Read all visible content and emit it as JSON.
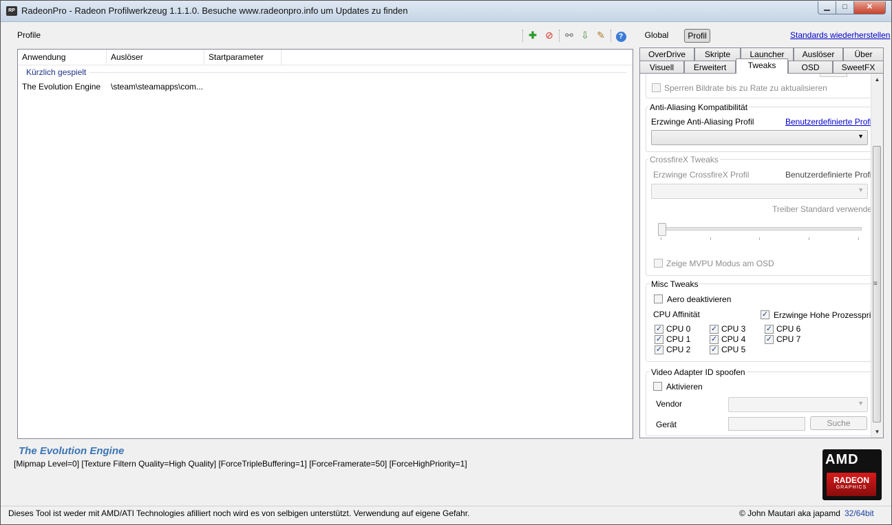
{
  "window": {
    "app_icon": "RP",
    "title": "RadeonPro - Radeon Profilwerkzeug 1.1.1.0. Besuche www.radeonpro.info um Updates zu finden",
    "min_icon": "minimize-icon",
    "max_icon": "maximize-icon",
    "close_icon": "close-icon"
  },
  "left": {
    "profile_label": "Profile",
    "toolbar": [
      {
        "name": "add-profile-icon",
        "glyph": "+"
      },
      {
        "name": "delete-profile-icon",
        "glyph": "⊘"
      },
      {
        "name": "link-icon",
        "glyph": "∞"
      },
      {
        "name": "import-icon",
        "glyph": "⇩"
      },
      {
        "name": "broom-icon",
        "glyph": "✎"
      },
      {
        "name": "help-icon",
        "glyph": "?"
      }
    ],
    "columns": [
      "Anwendung",
      "Auslöser",
      "Startparameter"
    ],
    "group": "Kürzlich gespielt",
    "rows": [
      {
        "app": "The Evolution Engine",
        "trigger": "\\steam\\steamapps\\com...",
        "params": ""
      }
    ]
  },
  "right": {
    "seg_global": "Global",
    "seg_profil": "Profil",
    "restore_link": "Standards wiederherstellen",
    "tabs_row1": [
      "OverDrive",
      "Skripte",
      "Launcher",
      "Auslöser",
      "Über"
    ],
    "tabs_row2": [
      "Visuell",
      "Erweitert",
      "Tweaks",
      "OSD",
      "SweetFX"
    ],
    "active_tab": "Tweaks",
    "lock_framerate": "Sperren Bildrate bis zu Rate zu aktualisieren",
    "aa_group": "Anti-Aliasing Kompatibilität",
    "aa_force": "Erzwinge Anti-Aliasing Profil",
    "aa_custom_link": "Benutzerdefinierte Profile v",
    "cfx_group": "CrossfireX Tweaks",
    "cfx_force": "Erzwinge CrossfireX Profil",
    "cfx_custom": "Benutzerdefinierte Profile v",
    "cfx_driver_default": "Treiber Standard verwenden",
    "cfx_slider_value": 0,
    "cfx_mvpu": "Zeige MVPU Modus am OSD",
    "misc_group": "Misc Tweaks",
    "aero": "Aero deaktivieren",
    "cpu_affinity": "CPU Affinität",
    "high_priority": "Erzwinge Hohe Prozesspriorität",
    "high_priority_checked": true,
    "cpus": [
      {
        "label": "CPU 0",
        "checked": true
      },
      {
        "label": "CPU 1",
        "checked": true
      },
      {
        "label": "CPU 2",
        "checked": true
      },
      {
        "label": "CPU 3",
        "checked": true
      },
      {
        "label": "CPU 4",
        "checked": true
      },
      {
        "label": "CPU 5",
        "checked": true
      },
      {
        "label": "CPU 6",
        "checked": true
      },
      {
        "label": "CPU 7",
        "checked": true
      }
    ],
    "vendor_group": "Video Adapter ID spoofen",
    "vendor_enable": "Aktivieren",
    "vendor_label": "Vendor",
    "device_label": "Gerät",
    "search_button": "Suche"
  },
  "bottom": {
    "game_title": "The Evolution Engine",
    "params": "[Mipmap Level=0] [Texture Filtern Quality=High Quality] [ForceTripleBuffering=1] [ForceFramerate=50] [ForceHighPriority=1]",
    "logo_amd": "AMD",
    "logo_radeon": "RADEON",
    "logo_graphics": "GRAPHICS"
  },
  "status": {
    "disclaimer": "Dieses Tool ist weder mit AMD/ATI Technologies afilliert noch wird es von selbigen unterstützt. Verwendung auf eigene Gefahr.",
    "author": "© John Mautari aka japamd",
    "bitness": "32/64bit"
  }
}
